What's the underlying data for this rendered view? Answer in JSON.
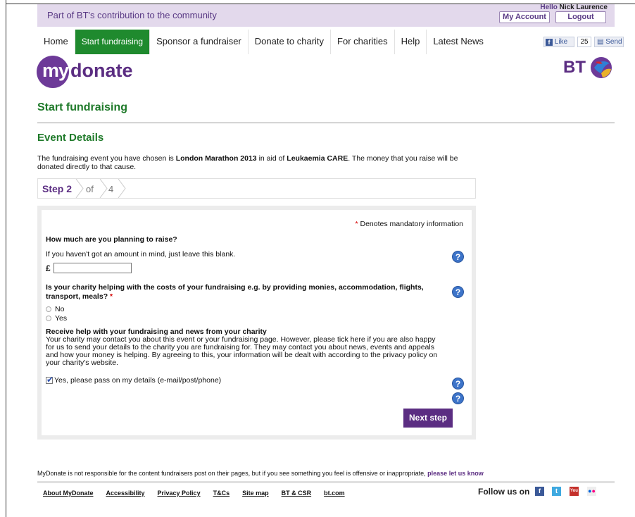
{
  "header": {
    "community_text": "Part of BT's contribution to the community",
    "greeting_prefix": "Hello",
    "user_name": "Nick Laurence",
    "my_account_label": "My Account",
    "logout_label": "Logout"
  },
  "nav": {
    "items": [
      {
        "label": "Home"
      },
      {
        "label": "Start fundraising",
        "active": true
      },
      {
        "label": "Sponsor a fundraiser"
      },
      {
        "label": "Donate to charity"
      },
      {
        "label": "For charities"
      },
      {
        "label": "Help"
      },
      {
        "label": "Latest News"
      }
    ],
    "fb_like_label": "Like",
    "fb_like_count": "25",
    "fb_send_label": "Send"
  },
  "brand": {
    "logo_my": "my",
    "logo_donate": "donate",
    "bt_logo": "BT",
    "accent_color": "#5b2d82",
    "green_color": "#1f8a2e"
  },
  "page": {
    "title": "Start fundraising",
    "section_title": "Event Details",
    "intro_prefix": "The fundraising event you have chosen is",
    "event_name": "London Marathon 2013",
    "intro_middle": "in aid of",
    "charity_name": "Leukaemia CARE",
    "intro_suffix": ". The money that you raise will be donated directly to that cause."
  },
  "steps": {
    "current_label": "Step 2",
    "of_label": "of",
    "total": "4"
  },
  "form": {
    "mandatory_note": "Denotes mandatory information",
    "q_amount": "How much are you planning to raise?",
    "amount_hint": "If you haven't got an amount in mind, just leave this blank.",
    "currency_symbol": "£",
    "amount_value": "",
    "q_costs": "Is your charity helping with the costs of your fundraising e.g. by providing monies, accommodation, flights, transport, meals?",
    "option_no": "No",
    "option_yes": "Yes",
    "help_heading": "Receive help with your fundraising and news from your charity",
    "help_text": "Your charity may contact you about this event or your fundraising page. However, please tick here if you are also happy for us to send your details to the charity you are fundraising for. They may contact you about news, events and appeals and how your money is helping. By agreeing to this, your information will be dealt with according to the privacy policy on your charity's website.",
    "consent_label": "Yes, please pass on my details (e-mail/post/phone)",
    "consent_checked": true,
    "next_label": "Next step",
    "help_icon_glyph": "?"
  },
  "footer": {
    "disclaimer": "MyDonate is not responsible for the content fundraisers post on their pages, but if you see something you feel is offensive or inappropriate,",
    "disclaimer_link": "please let us know",
    "links": [
      "About MyDonate",
      "Accessibility",
      "Privacy Policy",
      "T&Cs",
      "Site map",
      "BT & CSR",
      "bt.com"
    ],
    "follow_label": "Follow us on",
    "social_icons": [
      "facebook-icon",
      "twitter-icon",
      "youtube-icon",
      "flickr-icon"
    ]
  }
}
